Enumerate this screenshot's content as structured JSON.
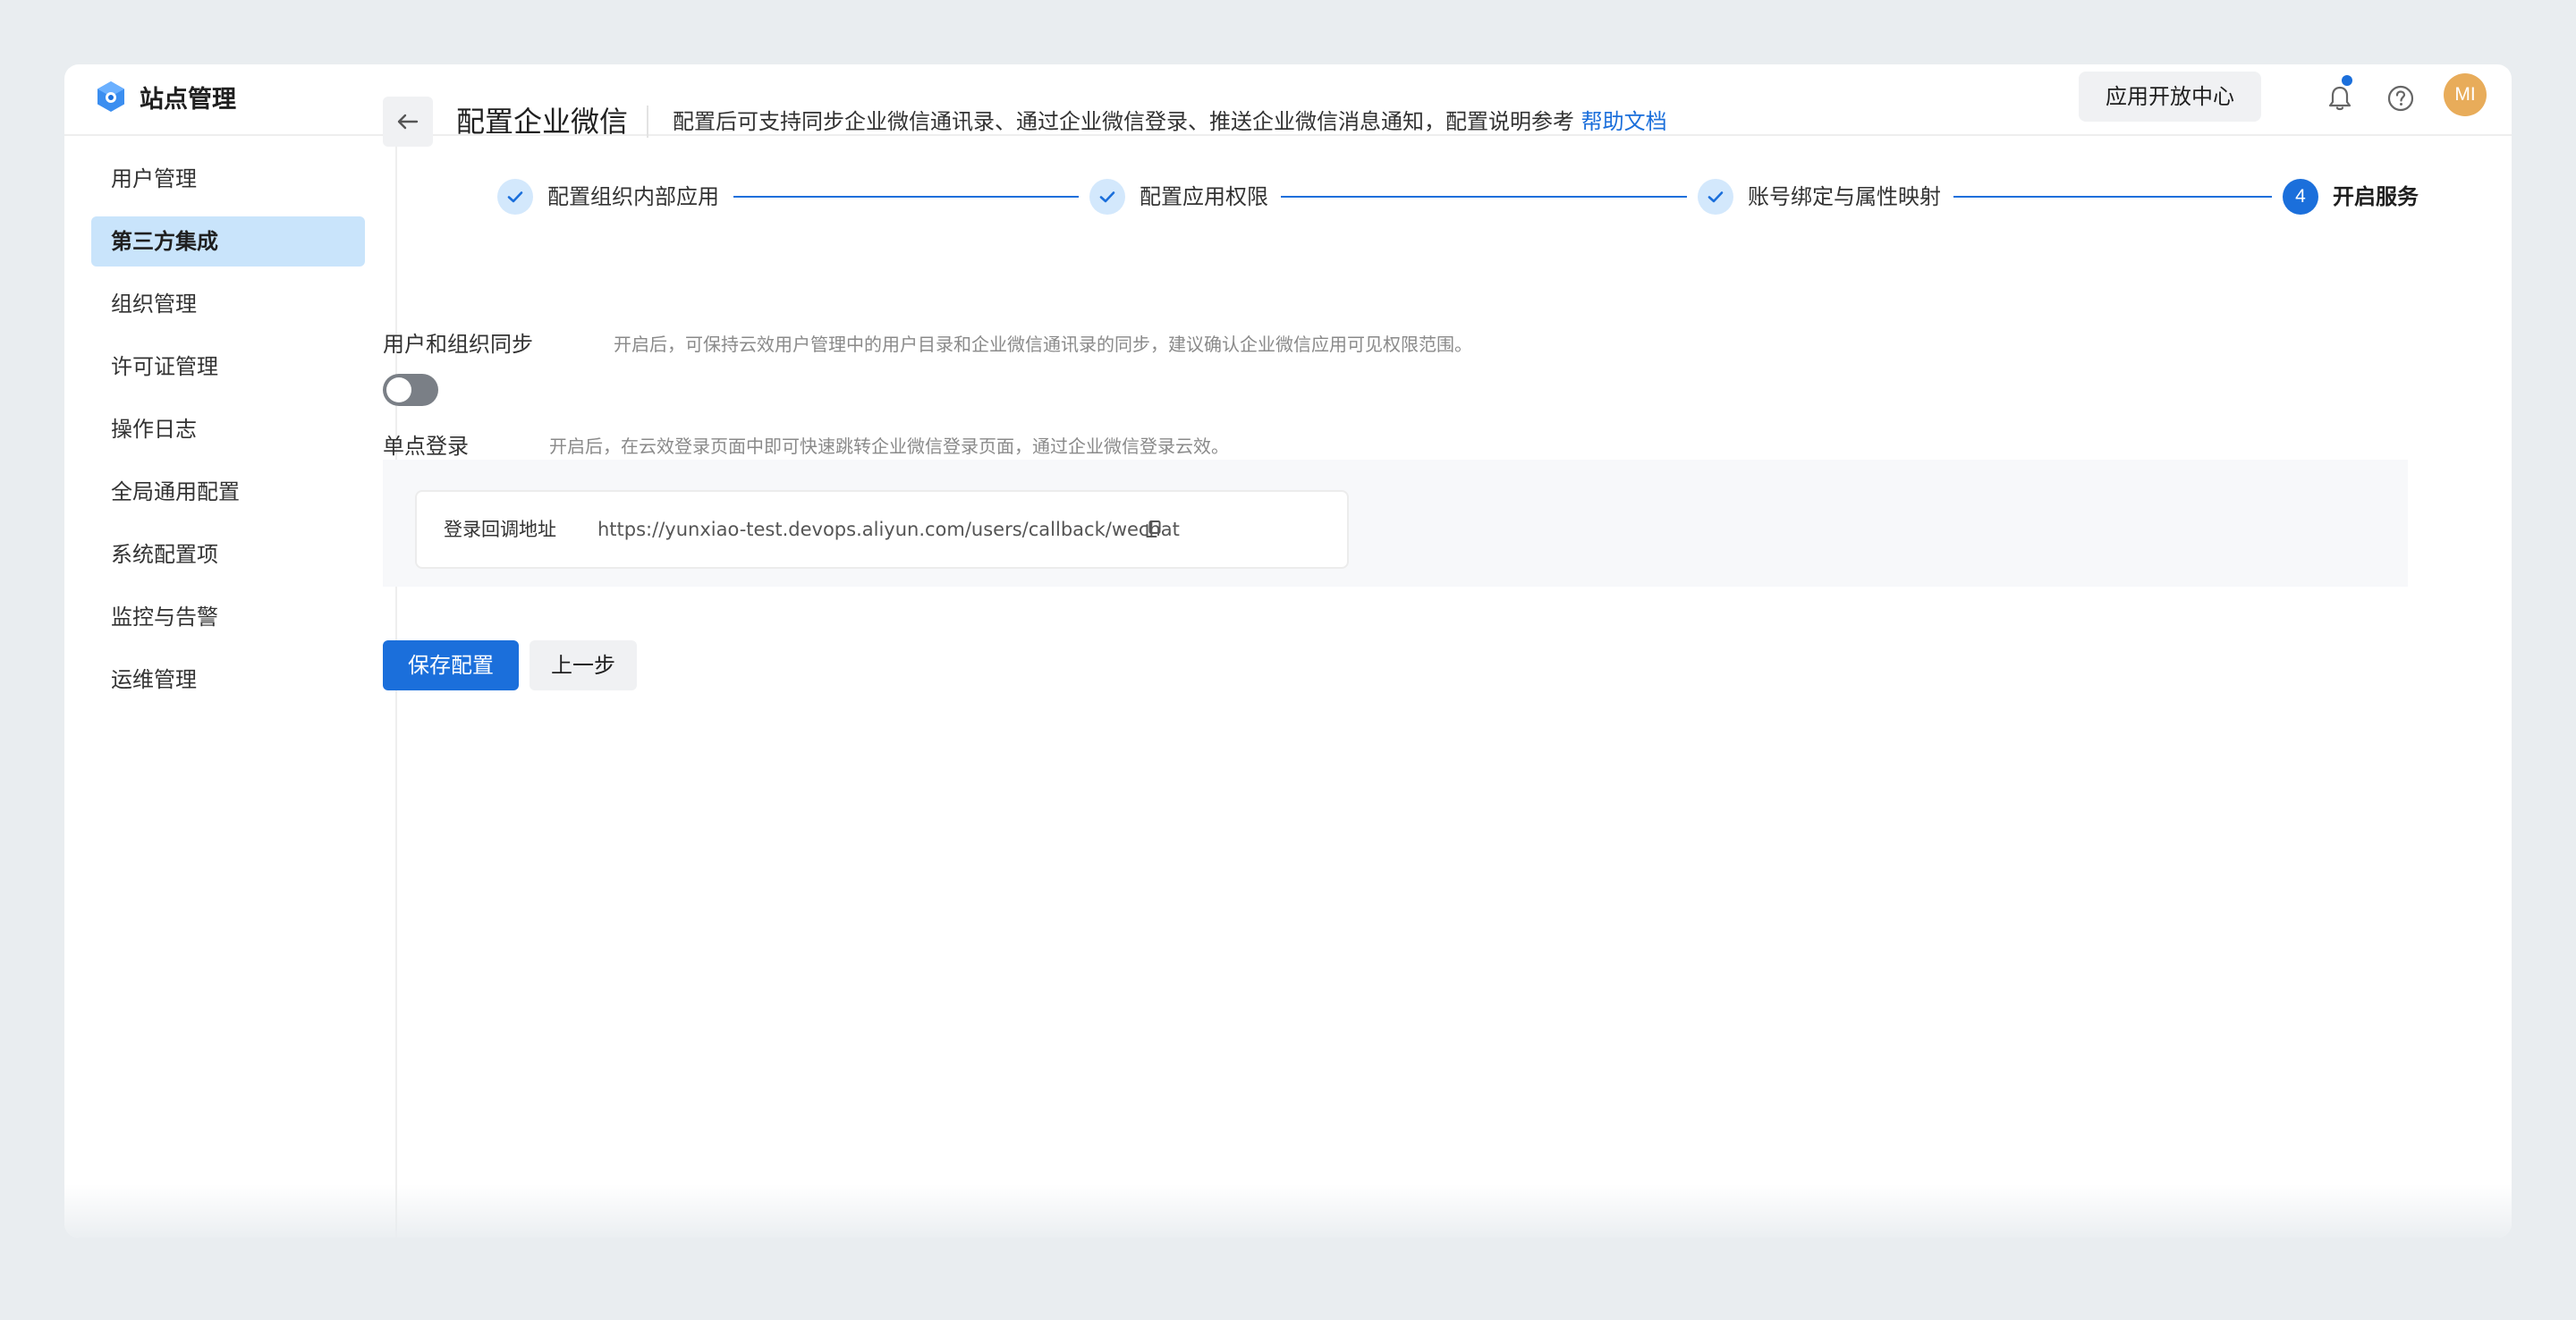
{
  "header": {
    "site_title": "站点管理",
    "open_center_label": "应用开放中心",
    "avatar_initials": "MI",
    "has_notification": true
  },
  "sidebar": {
    "items": [
      {
        "label": "用户管理",
        "active": false
      },
      {
        "label": "第三方集成",
        "active": true
      },
      {
        "label": "组织管理",
        "active": false
      },
      {
        "label": "许可证管理",
        "active": false
      },
      {
        "label": "操作日志",
        "active": false
      },
      {
        "label": "全局通用配置",
        "active": false
      },
      {
        "label": "系统配置项",
        "active": false
      },
      {
        "label": "监控与告警",
        "active": false
      },
      {
        "label": "运维管理",
        "active": false
      }
    ]
  },
  "page": {
    "title": "配置企业微信",
    "description": "配置后可支持同步企业微信通讯录、通过企业微信登录、推送企业微信消息通知，配置说明参考",
    "help_link": "帮助文档"
  },
  "steps": [
    {
      "label": "配置组织内部应用",
      "status": "done"
    },
    {
      "label": "配置应用权限",
      "status": "done"
    },
    {
      "label": "账号绑定与属性映射",
      "status": "done"
    },
    {
      "label": "开启服务",
      "status": "current",
      "number": "4"
    }
  ],
  "sections": {
    "sync": {
      "title": "用户和组织同步",
      "description": "开启后，可保持云效用户管理中的用户目录和企业微信通讯录的同步，建议确认企业微信应用可见权限范围。",
      "enabled": false
    },
    "sso": {
      "title": "单点登录",
      "description": "开启后，在云效登录页面中即可快速跳转企业微信登录页面，通过企业微信登录云效。",
      "enabled": true,
      "callback_label": "登录回调地址",
      "callback_url": "https://yunxiao-test.devops.aliyun.com/users/callback/wechat"
    }
  },
  "actions": {
    "save_label": "保存配置",
    "prev_label": "上一步"
  },
  "colors": {
    "accent": "#1b6fdb",
    "active_nav_bg": "#c9e4fb",
    "toggle_on": "#1b8ae8",
    "toggle_off": "#7a7f86",
    "avatar_bg": "#e8ac5a"
  }
}
